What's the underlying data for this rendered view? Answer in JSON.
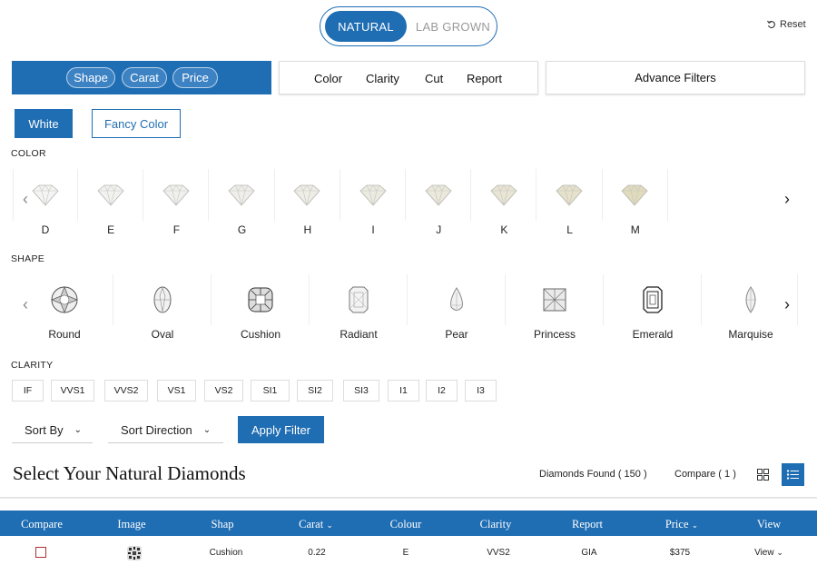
{
  "toggle": {
    "natural": "NATURAL",
    "lab": "LAB GROWN"
  },
  "reset_label": "Reset",
  "tabs1": [
    "Shape",
    "Carat",
    "Price"
  ],
  "tabs2": [
    "Color",
    "Clarity",
    "Cut",
    "Report"
  ],
  "advance_label": "Advance Filters",
  "white_label": "White",
  "fancy_label": "Fancy Color",
  "color_section": "COLOR",
  "colors": [
    "D",
    "E",
    "F",
    "G",
    "H",
    "I",
    "J",
    "K",
    "L",
    "M"
  ],
  "shape_section": "SHAPE",
  "shapes": [
    "Round",
    "Oval",
    "Cushion",
    "Radiant",
    "Pear",
    "Princess",
    "Emerald",
    "Marquise"
  ],
  "clarity_section": "CLARITY",
  "clarities": [
    "IF",
    "VVS1",
    "VVS2",
    "VS1",
    "VS2",
    "SI1",
    "SI2",
    "SI3",
    "I1",
    "I2",
    "I3"
  ],
  "sort_by": "Sort By",
  "sort_direction": "Sort Direction",
  "apply_label": "Apply Filter",
  "page_title": "Select Your Natural Diamonds",
  "found_text": "Diamonds Found ( 150 )",
  "compare_text": "Compare ( 1 )",
  "table": {
    "headers": [
      "Compare",
      "Image",
      "Shap",
      "Carat",
      "Colour",
      "Clarity",
      "Report",
      "Price",
      "View"
    ],
    "rows": [
      {
        "shape": "Cushion",
        "carat": "0.22",
        "colour": "E",
        "clarity": "VVS2",
        "report": "GIA",
        "price": "$375",
        "view": "View"
      }
    ]
  },
  "accent_color": "#1f6db3"
}
